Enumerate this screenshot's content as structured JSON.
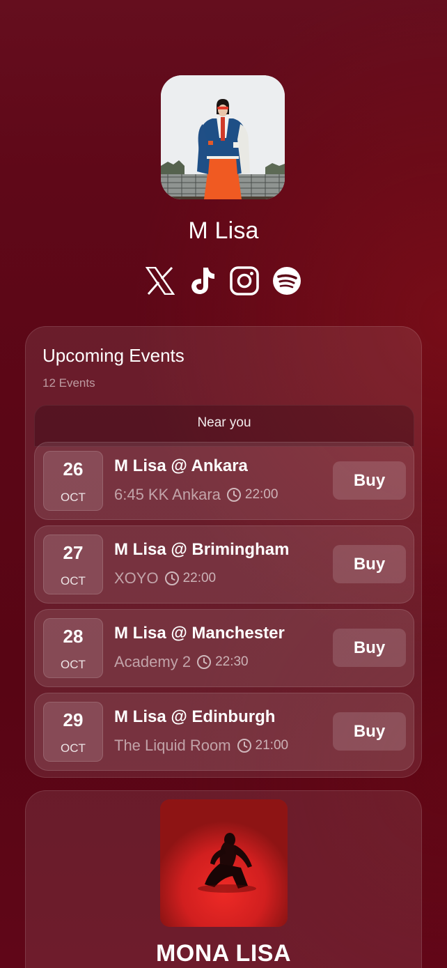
{
  "profile": {
    "name": "M Lisa",
    "socials": [
      {
        "icon": "x-icon"
      },
      {
        "icon": "tiktok-icon"
      },
      {
        "icon": "instagram-icon"
      },
      {
        "icon": "spotify-icon"
      }
    ]
  },
  "events": {
    "title": "Upcoming Events",
    "count": "12 Events",
    "section_label": "Near you",
    "items": [
      {
        "day": "26",
        "month": "OCT",
        "title": "M Lisa @ Ankara",
        "venue": "6:45 KK Ankara",
        "time": "22:00",
        "button": "Buy"
      },
      {
        "day": "27",
        "month": "OCT",
        "title": "M Lisa @ Brimingham",
        "venue": "XOYO",
        "time": "22:00",
        "button": "Buy"
      },
      {
        "day": "28",
        "month": "OCT",
        "title": "M Lisa @ Manchester",
        "venue": "Academy 2",
        "time": "22:30",
        "button": "Buy"
      },
      {
        "day": "29",
        "month": "OCT",
        "title": "M Lisa @ Edinburgh",
        "venue": "The Liquid Room",
        "time": "21:00",
        "button": "Buy"
      }
    ]
  },
  "album": {
    "title": "MONA LISA"
  },
  "colors": {
    "background": "#5b0616",
    "album_red": "#e62424"
  }
}
